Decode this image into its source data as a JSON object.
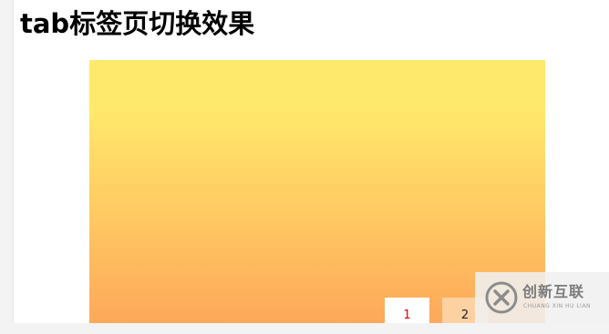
{
  "page": {
    "title": "tab标签页切换效果"
  },
  "tabs": [
    {
      "label": "1",
      "active": true
    },
    {
      "label": "2",
      "active": false
    }
  ],
  "panel": {
    "gradient_colors": [
      "#ffe96c",
      "#ffca62",
      "#fda85a"
    ]
  },
  "watermark": {
    "name_cn": "创新互联",
    "name_en": "CHUANG XIN HU LIAN",
    "logo_icon": "x-logo-icon"
  },
  "colors": {
    "active_tab_text": "#d80000",
    "inactive_tab_bg": "#fed1a3",
    "active_tab_bg": "#ffffff"
  }
}
